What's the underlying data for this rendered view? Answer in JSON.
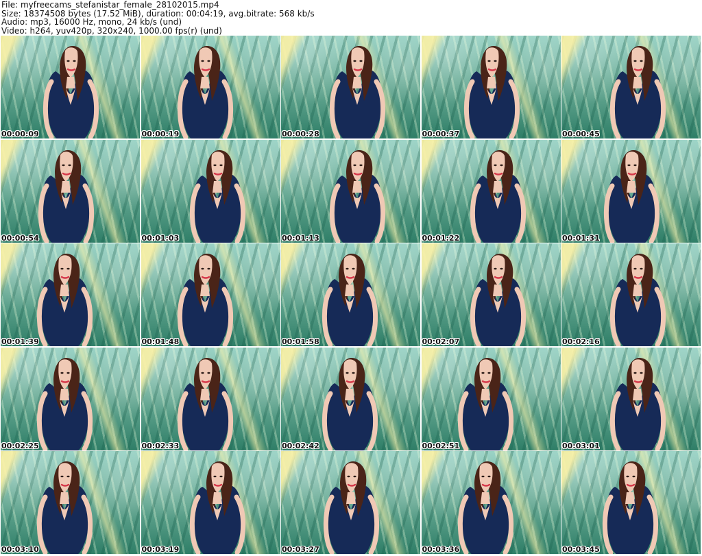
{
  "header": {
    "lines": [
      "File: myfreecams_stefanistar_female_28102015.mp4",
      "Size: 18374508 bytes (17.52 MiB), duration: 00:04:19, avg.bitrate: 568 kb/s",
      "Audio: mp3, 16000 Hz, mono, 24 kb/s (und)",
      "Video: h264, yuv420p, 320x240, 1000.00 fps(r) (und)"
    ]
  },
  "thumbnails": [
    {
      "time": "00:00:09"
    },
    {
      "time": "00:00:19"
    },
    {
      "time": "00:00:28"
    },
    {
      "time": "00:00:37"
    },
    {
      "time": "00:00:45"
    },
    {
      "time": "00:00:54"
    },
    {
      "time": "00:01:03"
    },
    {
      "time": "00:01:13"
    },
    {
      "time": "00:01:22"
    },
    {
      "time": "00:01:31"
    },
    {
      "time": "00:01:39"
    },
    {
      "time": "00:01:48"
    },
    {
      "time": "00:01:58"
    },
    {
      "time": "00:02:07"
    },
    {
      "time": "00:02:16"
    },
    {
      "time": "00:02:25"
    },
    {
      "time": "00:02:33"
    },
    {
      "time": "00:02:42"
    },
    {
      "time": "00:02:51"
    },
    {
      "time": "00:03:01"
    },
    {
      "time": "00:03:10"
    },
    {
      "time": "00:03:19"
    },
    {
      "time": "00:03:27"
    },
    {
      "time": "00:03:36"
    },
    {
      "time": "00:03:45"
    }
  ],
  "colors": {
    "text": "#111111",
    "timestamp_outline": "#ffffff",
    "dress": "#162a57",
    "hair": "#4a2418",
    "skin": "#f0c9b5",
    "lips": "#d6384a",
    "background_green": "#6cad98",
    "background_highlight": "#fff09a"
  }
}
